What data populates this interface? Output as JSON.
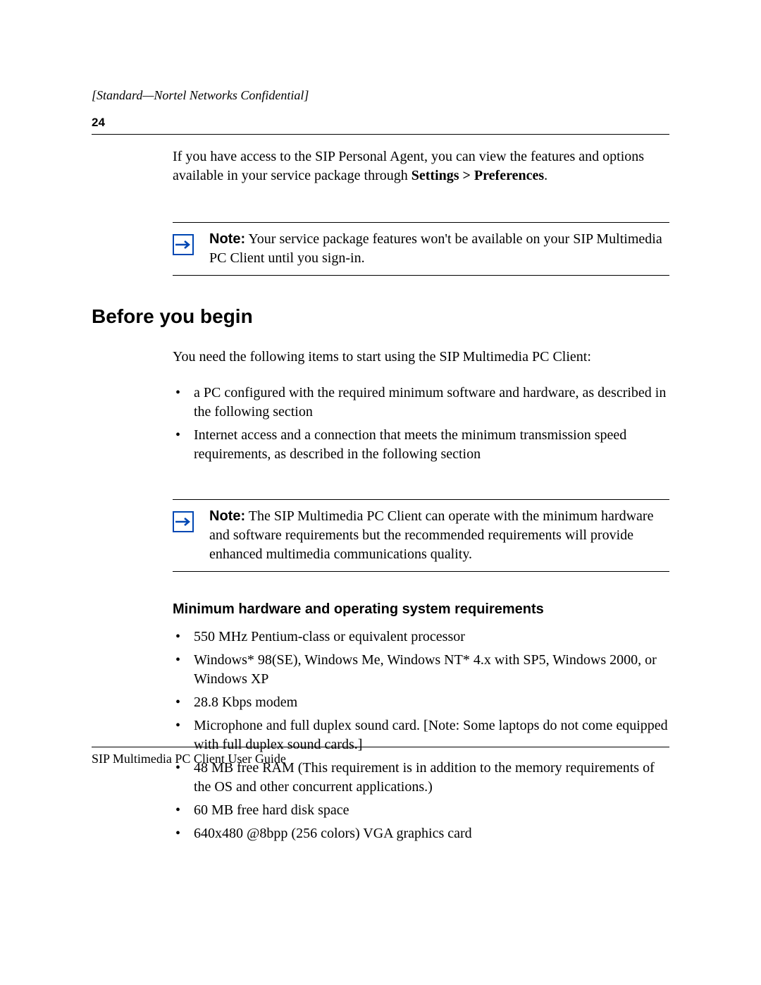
{
  "header": {
    "classification": "[Standard—Nortel Networks Confidential]",
    "page_number": "24"
  },
  "intro_paragraph": {
    "text_before_bold": "If you have access to the SIP Personal Agent, you can view the features and options available in your service package through ",
    "bold_text": "Settings > Preferences",
    "text_after_bold": "."
  },
  "note1": {
    "label": "Note:",
    "text": " Your service package features won't be available on your SIP Multimedia PC Client until you sign-in."
  },
  "section_heading": "Before you begin",
  "section_intro": "You need the following items to start using the SIP Multimedia PC Client:",
  "items_list1": [
    "a PC configured with the required minimum software and hardware, as described in the following section",
    "Internet access and a connection that meets the minimum transmission speed requirements, as described in the following section"
  ],
  "note2": {
    "label": "Note:",
    "text": " The SIP Multimedia PC Client can operate with the minimum hardware and software requirements but the recommended requirements will provide enhanced multimedia communications quality."
  },
  "sub_heading": "Minimum hardware and operating system requirements",
  "items_list2": [
    "550 MHz Pentium-class or equivalent processor",
    "Windows* 98(SE), Windows Me, Windows NT* 4.x with SP5, Windows 2000, or Windows XP",
    "28.8 Kbps modem",
    "Microphone and full duplex sound card. [Note: Some laptops do not come equipped with full duplex sound cards.]",
    "48 MB free RAM (This requirement is in addition to the memory requirements of the OS and other concurrent applications.)",
    "60 MB free hard disk space",
    "640x480 @8bpp (256 colors) VGA graphics card"
  ],
  "footer": {
    "text": "SIP Multimedia PC Client User Guide"
  }
}
